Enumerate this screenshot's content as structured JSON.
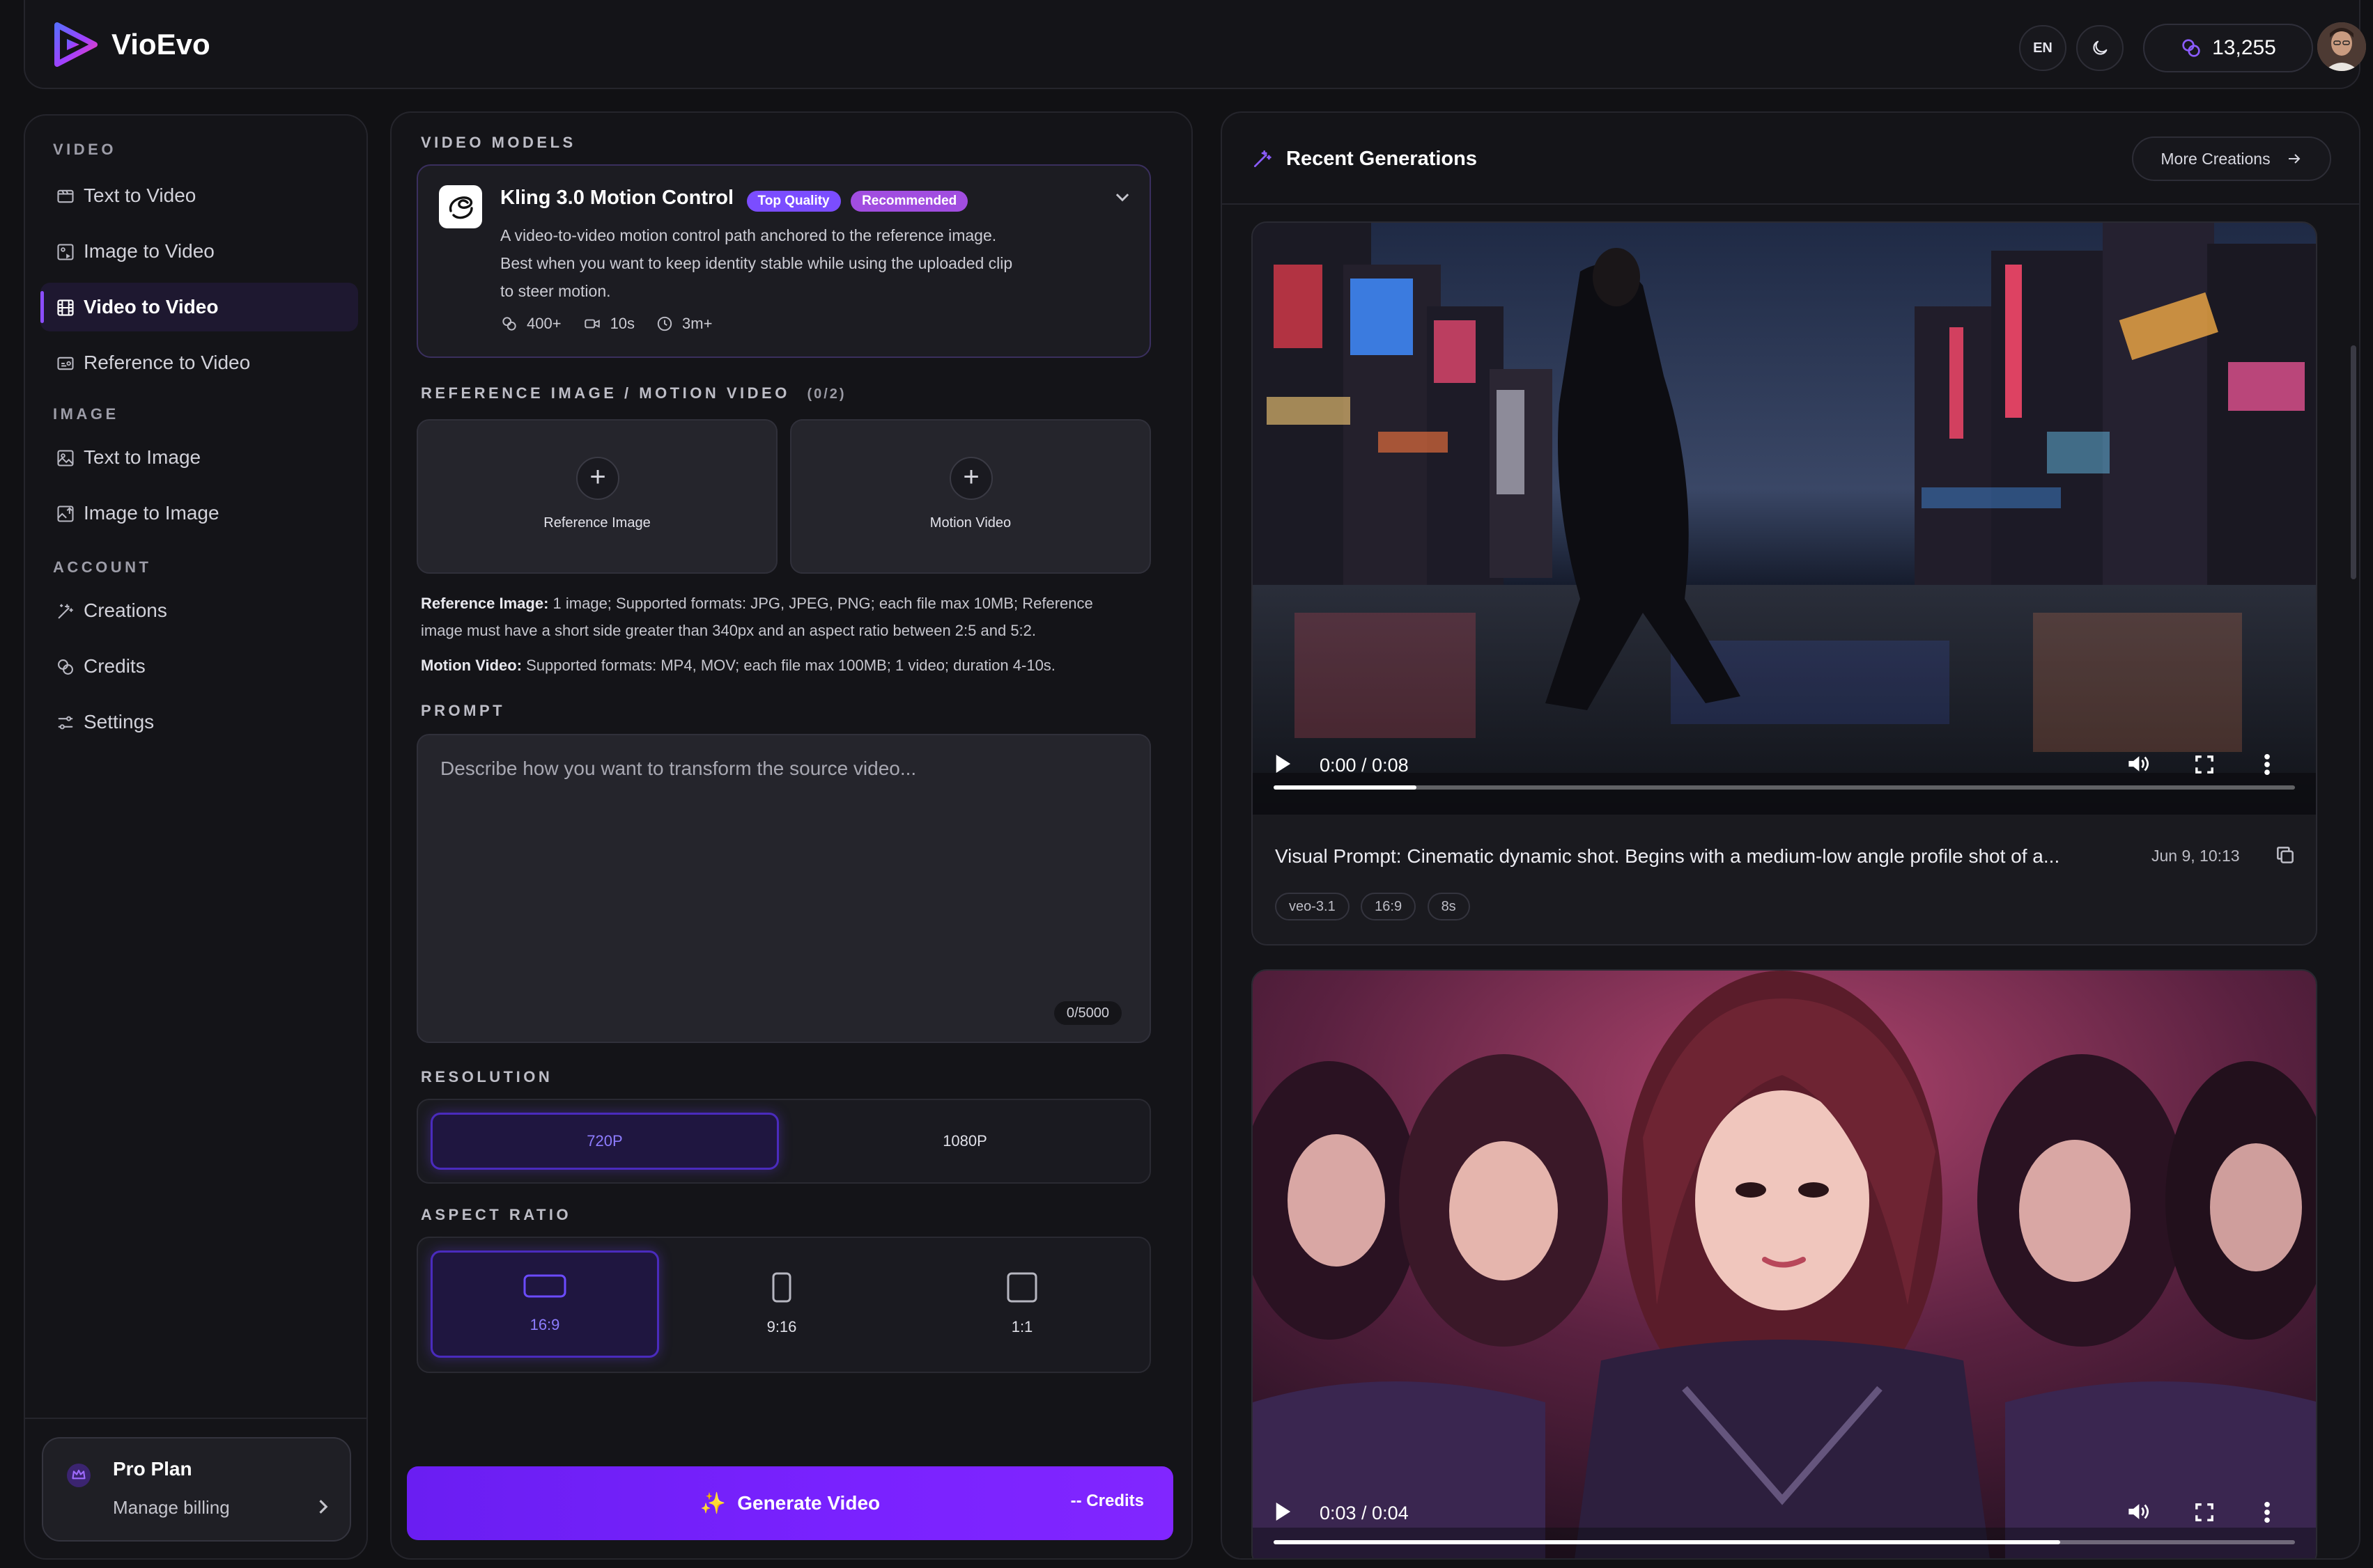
{
  "brand": {
    "name": "VioEvo",
    "language": "EN",
    "credits": "13,255"
  },
  "sidebar": {
    "sections": [
      "VIDEO",
      "IMAGE",
      "ACCOUNT"
    ],
    "items": [
      {
        "label": "Text to Video",
        "icon": "text-video-icon"
      },
      {
        "label": "Image to Video",
        "icon": "image-video-icon"
      },
      {
        "label": "Video to Video",
        "icon": "film-icon",
        "active": true
      },
      {
        "label": "Reference to Video",
        "icon": "reference-icon"
      },
      {
        "label": "Text to Image",
        "icon": "text-image-icon"
      },
      {
        "label": "Image to Image",
        "icon": "image-image-icon"
      },
      {
        "label": "Creations",
        "icon": "magic-wand-icon"
      },
      {
        "label": "Credits",
        "icon": "coins-icon"
      },
      {
        "label": "Settings",
        "icon": "sliders-icon"
      }
    ],
    "plan": {
      "title": "Pro Plan",
      "subtitle": "Manage billing"
    }
  },
  "form": {
    "models_label": "VIDEO MODELS",
    "model": {
      "name": "Kling 3.0 Motion Control",
      "badge_top": "Top Quality",
      "badge_rec": "Recommended",
      "desc1": "A video-to-video motion control path anchored to the reference image.",
      "desc2": "Best when you want to keep identity stable while using the uploaded clip",
      "desc3": "to steer motion.",
      "stat_uses": "400+",
      "stat_length": "10s",
      "stat_time": "3m+"
    },
    "ref_label": "REFERENCE IMAGE / MOTION VIDEO",
    "ref_count": "(0/2)",
    "upload_ref": "Reference Image",
    "upload_motion": "Motion Video",
    "info_ref_title": "Reference Image:",
    "info_ref_1": " 1 image; Supported formats: JPG, JPEG, PNG; each file max 10MB; Reference",
    "info_ref_2": "image must have a short side greater than 340px and an aspect ratio between 2:5 and 5:2.",
    "info_motion_title": "Motion Video:",
    "info_motion": " Supported formats: MP4, MOV; each file max 100MB; 1 video; duration 4-10s.",
    "prompt_label": "PROMPT",
    "prompt_placeholder": "Describe how you want to transform the source video...",
    "prompt_count": "0/5000",
    "resolution_label": "RESOLUTION",
    "resolutions": [
      "720P",
      "1080P"
    ],
    "aspect_label": "ASPECT RATIO",
    "aspects": [
      "16:9",
      "9:16",
      "1:1"
    ],
    "generate_label": "Generate Video",
    "generate_credits": "-- Credits"
  },
  "recent": {
    "title": "Recent Generations",
    "more": "More Creations",
    "items": [
      {
        "time": "0:00 / 0:08",
        "progress": 0.14,
        "prompt": "Visual Prompt: Cinematic dynamic shot. Begins with a medium-low angle profile shot of a...",
        "date": "Jun 9, 10:13",
        "tags": [
          "veo-3.1",
          "16:9",
          "8s"
        ]
      },
      {
        "time": "0:03 / 0:04",
        "progress": 0.77
      }
    ]
  },
  "colors": {
    "accent": "#7b4dff",
    "background": "#111114",
    "panel": "#141418"
  }
}
